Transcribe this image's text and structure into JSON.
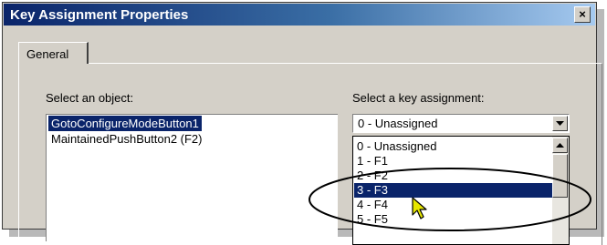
{
  "window": {
    "title": "Key Assignment Properties",
    "close_glyph": "×"
  },
  "tabs": [
    {
      "label": "General",
      "selected": true
    }
  ],
  "object_section": {
    "label": "Select an object:",
    "items": [
      {
        "label": "GotoConfigureModeButton1",
        "selected": true
      },
      {
        "label": "MaintainedPushButton2 (F2)",
        "selected": false
      }
    ]
  },
  "key_section": {
    "label": "Select a key assignment:",
    "combo_value": "0 - Unassigned",
    "dropdown_options": [
      {
        "label": "0 - Unassigned",
        "selected": false
      },
      {
        "label": "1 - F1",
        "selected": false
      },
      {
        "label": "2 - F2",
        "selected": false
      },
      {
        "label": "3 - F3",
        "selected": true
      },
      {
        "label": "4 - F4",
        "selected": false
      },
      {
        "label": "5 - F5",
        "selected": false
      }
    ]
  },
  "colors": {
    "title_gradient_start": "#0a246a",
    "title_gradient_end": "#a6caf0",
    "selection": "#0a246a",
    "dialog_face": "#d4d0c8",
    "cursor": "#e6e600"
  },
  "icons": {
    "close": "close-icon",
    "dropdown": "chevron-down-icon",
    "scroll_up": "chevron-up-icon",
    "pointer": "mouse-pointer-icon"
  }
}
